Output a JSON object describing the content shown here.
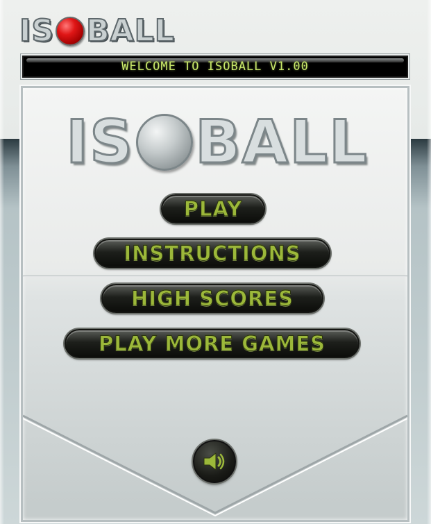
{
  "logo": {
    "left_letters": "IS",
    "right_letters": "BALL"
  },
  "welcome": {
    "text": "WELCOME TO ISOBALL V1.00"
  },
  "title": {
    "left_letters": "IS",
    "right_letters": "BALL"
  },
  "menu": {
    "play": "PLAY",
    "instructions": "INSTRUCTIONS",
    "high_scores": "HIGH SCORES",
    "more_games": "PLAY MORE GAMES"
  },
  "icons": {
    "logo_ball": "red-ball-icon",
    "title_ball": "grey-ball-icon",
    "sound": "speaker-icon"
  },
  "colors": {
    "button_text": "#9cb83a",
    "welcome_text": "#c8e86a",
    "logo_ball": "#e01616"
  }
}
